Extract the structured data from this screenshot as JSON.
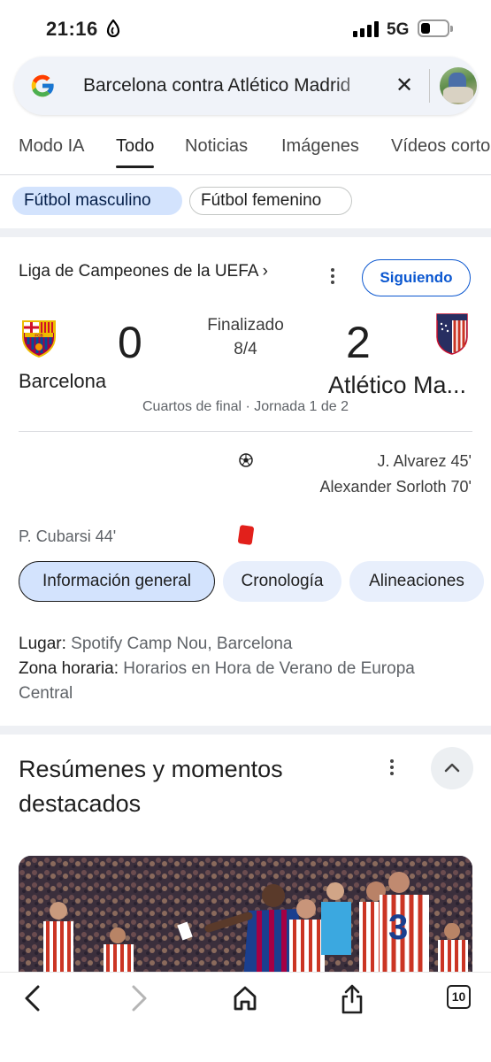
{
  "status_bar": {
    "time": "21:16",
    "network": "5G"
  },
  "search": {
    "query": "Barcelona contra Atlético Madrid"
  },
  "tabs": [
    {
      "label": "Modo IA"
    },
    {
      "label": "Todo",
      "active": true
    },
    {
      "label": "Noticias"
    },
    {
      "label": "Imágenes"
    },
    {
      "label": "Vídeos cortos"
    }
  ],
  "chips": {
    "selected": "Fútbol masculino",
    "other": "Fútbol femenino"
  },
  "match": {
    "league": "Liga de Campeones de la UEFA ›",
    "follow_label": "Siguiendo",
    "home_team": "Barcelona",
    "away_team": "Atlético Ma...",
    "home_score": "0",
    "away_score": "2",
    "status": "Finalizado",
    "date": "8/4",
    "round": "Cuartos de final · Jornada 1 de 2",
    "away_goals": [
      "J. Alvarez 45'",
      "Alexander Sorloth 70'"
    ],
    "home_card": "P. Cubarsi 44'",
    "subtabs": [
      "Información general",
      "Cronología",
      "Alineaciones"
    ],
    "venue_label": "Lugar:",
    "venue": "Spotify Camp Nou, Barcelona",
    "timezone_label": "Zona horaria:",
    "timezone": "Horarios en Hora de Verano de Europa Central"
  },
  "highlights": {
    "title": "Resúmenes y momentos destacados"
  },
  "toolbar": {
    "tab_count": "10"
  },
  "colors": {
    "accent_blue": "#0b57d0",
    "chip_selected_bg": "#d3e3fd",
    "red_card": "#e2201b"
  }
}
